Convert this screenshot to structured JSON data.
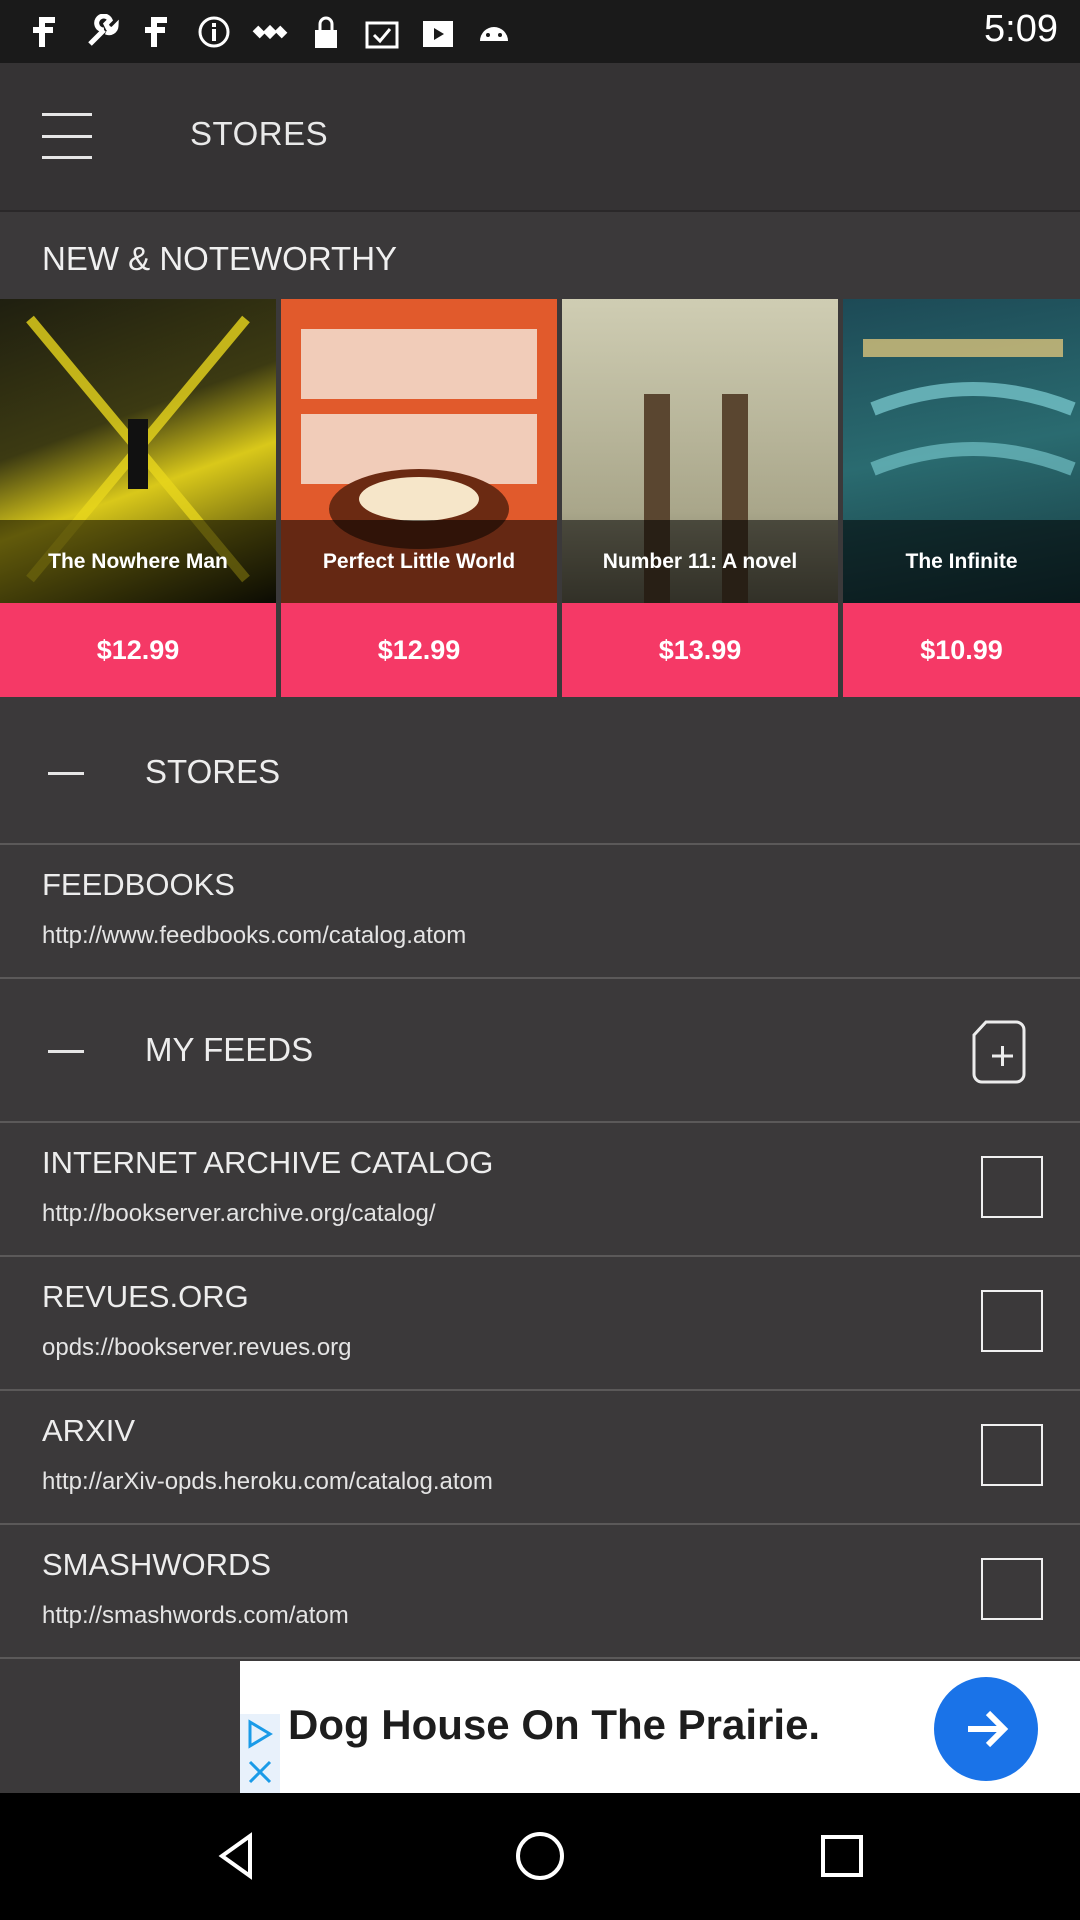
{
  "status_bar": {
    "time": "5:09",
    "left_icons": [
      "f-icon",
      "wrench-icon",
      "f-icon",
      "info-icon",
      "satellite-icon",
      "lock-icon",
      "clipboard-icon",
      "play-store-icon",
      "android-icon"
    ],
    "right_icons": []
  },
  "app_bar": {
    "title": "STORES",
    "menu_icon": "hamburger-icon"
  },
  "new_noteworthy": {
    "label": "NEW & NOTEWORTHY",
    "books": [
      {
        "title": "The Nowhere Man",
        "price": "$12.99",
        "cover_color": "#d9c81a"
      },
      {
        "title": "Perfect Little World",
        "price": "$12.99",
        "cover_color": "#e15a2c"
      },
      {
        "title": "Number 11: A novel",
        "price": "$13.99",
        "cover_color": "#b4b29a"
      },
      {
        "title": "The Infinite",
        "price": "$10.99",
        "cover_color": "#2a6b70"
      }
    ]
  },
  "stores_section": {
    "label": "STORES",
    "items": [
      {
        "title": "FEEDBOOKS",
        "url": "http://www.feedbooks.com/catalog.atom"
      }
    ]
  },
  "my_feeds_section": {
    "label": "MY FEEDS",
    "add_icon": "add-feed-icon",
    "items": [
      {
        "title": "INTERNET ARCHIVE CATALOG",
        "url": "http://bookserver.archive.org/catalog/",
        "checked": false
      },
      {
        "title": "REVUES.ORG",
        "url": "opds://bookserver.revues.org",
        "checked": false
      },
      {
        "title": "ARXIV",
        "url": "http://arXiv-opds.heroku.com/catalog.atom",
        "checked": false
      },
      {
        "title": "SMASHWORDS",
        "url": "http://smashwords.com/atom",
        "checked": false
      }
    ]
  },
  "ad": {
    "text": "Dog House On The Prairie.",
    "accent": "#1a73e8"
  },
  "colors": {
    "price_band": "#f53966",
    "background": "#3b393a"
  }
}
